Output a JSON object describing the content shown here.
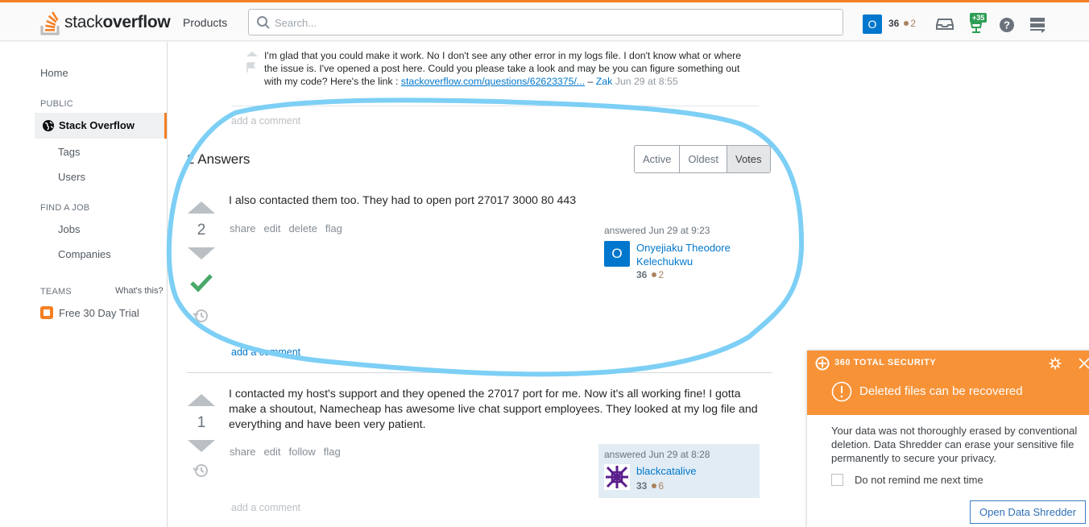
{
  "topbar": {
    "logo_text_light": "stack",
    "logo_text_bold": "overflow",
    "products_label": "Products",
    "search_placeholder": "Search...",
    "user_avatar_letter": "O",
    "reputation": "36",
    "bronze_badges": "2",
    "achievement_badge": "+35",
    "icons": [
      "inbox-icon",
      "achievements-icon",
      "help-icon",
      "site-switcher-icon"
    ],
    "accent_color": "#f48024"
  },
  "leftnav": {
    "home": "Home",
    "public_section": "PUBLIC",
    "stack_overflow": "Stack Overflow",
    "tags": "Tags",
    "users": "Users",
    "find_job_section": "FIND A JOB",
    "jobs": "Jobs",
    "companies": "Companies",
    "teams_section": "TEAMS",
    "whats_this": "What's this?",
    "free_trial": "Free 30 Day Trial"
  },
  "comment": {
    "text": "I'm glad that you could make it work. No I don't see any other error in my logs file. I don't know what or where the issue is. I've opened a post here. Could you please take a look and may be you can figure something out with my code? Here's the link : ",
    "link_text": "stackoverflow.com/questions/62623375/...",
    "separator": " – ",
    "user": "Zak",
    "date": " Jun 29 at 8:55"
  },
  "question_add_comment": "add a comment",
  "answers_header": "2 Answers",
  "sort_tabs": [
    "Active",
    "Oldest",
    "Votes"
  ],
  "sort_selected": "Votes",
  "answers": [
    {
      "votes": "2",
      "accepted": true,
      "text": "I also contacted them too. They had to open port 27017 3000 80 443",
      "actions": [
        "share",
        "edit",
        "delete",
        "flag"
      ],
      "answered": "answered Jun 29 at 9:23",
      "user_name": "Onyejiaku Theodore Kelechukwu",
      "user_avatar_letter": "O",
      "user_rep": "36",
      "user_bronze": "2",
      "add_comment": "add a comment"
    },
    {
      "votes": "1",
      "accepted": false,
      "text": "I contacted my host's support and they opened the 27017 port for me. Now it's all working fine! I gotta make a shoutout, Namecheap has awesome live chat support employees. They looked at my log file and everything and have been very patient.",
      "actions": [
        "share",
        "edit",
        "follow",
        "flag"
      ],
      "answered": "answered Jun 29 at 8:28",
      "user_name": "blackcatalive",
      "user_rep": "33",
      "user_bronze": "6",
      "add_comment": "add a comment"
    }
  ],
  "popup": {
    "brand": "360 TOTAL SECURITY",
    "title": "Deleted files can be recovered",
    "body": "Your data was not thoroughly erased by conventional deletion. Data Shredder can erase your sensitive file permanently to secure your privacy.",
    "checkbox_label": "Do not remind me next time",
    "button_label": "Open Data Shredder",
    "header_color": "#f79237"
  },
  "annotation_color": "#7dcff5"
}
